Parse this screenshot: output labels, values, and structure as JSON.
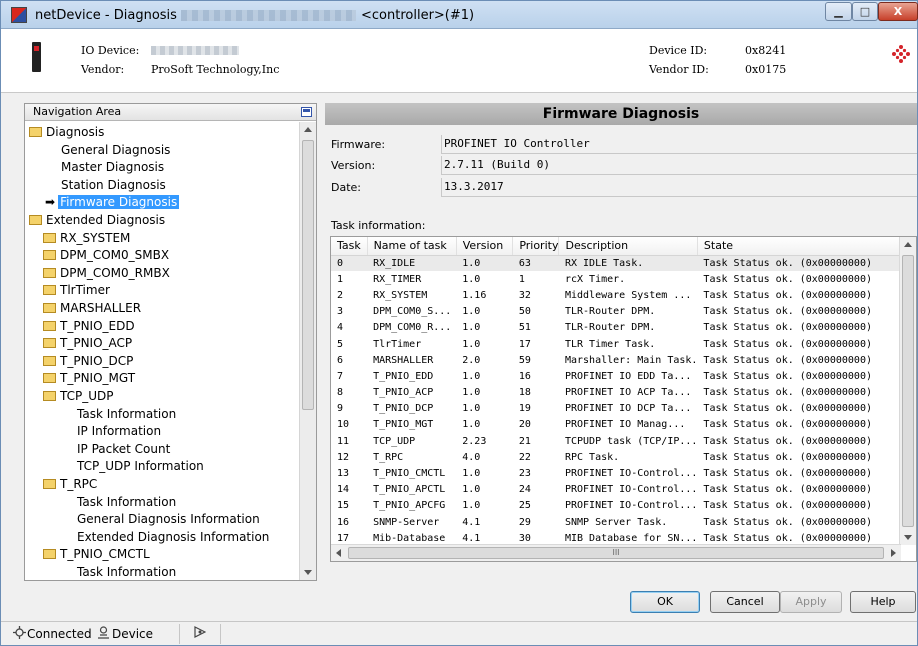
{
  "window": {
    "title": "netDevice - Diagnosis",
    "title_suffix": "<controller>(#1)",
    "minimize_glyph": "▁",
    "maximize_glyph": "□",
    "close_glyph": "X"
  },
  "header": {
    "io_device_label": "IO Device:",
    "vendor_label": "Vendor:",
    "vendor_value": "ProSoft Technology,Inc",
    "device_id_label": "Device ID:",
    "device_id_value": "0x8241",
    "vendor_id_label": "Vendor ID:",
    "vendor_id_value": "0x0175"
  },
  "nav": {
    "header": "Navigation Area",
    "items": [
      {
        "label": "Diagnosis",
        "level": 0,
        "folder": true
      },
      {
        "label": "General Diagnosis",
        "level": 1
      },
      {
        "label": "Master Diagnosis",
        "level": 1
      },
      {
        "label": "Station Diagnosis",
        "level": 1
      },
      {
        "label": "Firmware Diagnosis",
        "level": 1,
        "selected": true
      },
      {
        "label": "Extended Diagnosis",
        "level": 0,
        "folder": true
      },
      {
        "label": "RX_SYSTEM",
        "level": 1,
        "folder": true
      },
      {
        "label": "DPM_COM0_SMBX",
        "level": 1,
        "folder": true
      },
      {
        "label": "DPM_COM0_RMBX",
        "level": 1,
        "folder": true
      },
      {
        "label": "TlrTimer",
        "level": 1,
        "folder": true
      },
      {
        "label": "MARSHALLER",
        "level": 1,
        "folder": true
      },
      {
        "label": "T_PNIO_EDD",
        "level": 1,
        "folder": true
      },
      {
        "label": "T_PNIO_ACP",
        "level": 1,
        "folder": true
      },
      {
        "label": "T_PNIO_DCP",
        "level": 1,
        "folder": true
      },
      {
        "label": "T_PNIO_MGT",
        "level": 1,
        "folder": true
      },
      {
        "label": "TCP_UDP",
        "level": 1,
        "folder": true
      },
      {
        "label": "Task Information",
        "level": 2
      },
      {
        "label": "IP Information",
        "level": 2
      },
      {
        "label": "IP Packet Count",
        "level": 2
      },
      {
        "label": "TCP_UDP Information",
        "level": 2
      },
      {
        "label": "T_RPC",
        "level": 1,
        "folder": true
      },
      {
        "label": "Task Information",
        "level": 2
      },
      {
        "label": "General Diagnosis Information",
        "level": 2
      },
      {
        "label": "Extended Diagnosis Information",
        "level": 2
      },
      {
        "label": "T_PNIO_CMCTL",
        "level": 1,
        "folder": true
      },
      {
        "label": "Task Information",
        "level": 2
      }
    ]
  },
  "panel": {
    "title": "Firmware Diagnosis",
    "firmware_label": "Firmware:",
    "firmware_value": "PROFINET IO Controller",
    "version_label": "Version:",
    "version_value": "2.7.11 (Build 0)",
    "date_label": "Date:",
    "date_value": "13.3.2017",
    "task_info_label": "Task information:"
  },
  "table": {
    "columns": [
      "Task",
      "Name of task",
      "Version",
      "Priority",
      "Description",
      "State"
    ],
    "rows": [
      [
        "0",
        "RX_IDLE",
        "1.0",
        "63",
        "RX IDLE Task.",
        "Task Status ok. (0x00000000)"
      ],
      [
        "1",
        "RX_TIMER",
        "1.0",
        "1",
        "rcX Timer.",
        "Task Status ok. (0x00000000)"
      ],
      [
        "2",
        "RX_SYSTEM",
        "1.16",
        "32",
        "Middleware System ...",
        "Task Status ok. (0x00000000)"
      ],
      [
        "3",
        "DPM_COM0_S...",
        "1.0",
        "50",
        "TLR-Router DPM.",
        "Task Status ok. (0x00000000)"
      ],
      [
        "4",
        "DPM_COM0_R...",
        "1.0",
        "51",
        "TLR-Router DPM.",
        "Task Status ok. (0x00000000)"
      ],
      [
        "5",
        "TlrTimer",
        "1.0",
        "17",
        "TLR Timer Task.",
        "Task Status ok. (0x00000000)"
      ],
      [
        "6",
        "MARSHALLER",
        "2.0",
        "59",
        "Marshaller: Main Task.",
        "Task Status ok. (0x00000000)"
      ],
      [
        "7",
        "T_PNIO_EDD",
        "1.0",
        "16",
        "PROFINET IO EDD Ta...",
        "Task Status ok. (0x00000000)"
      ],
      [
        "8",
        "T_PNIO_ACP",
        "1.0",
        "18",
        "PROFINET IO ACP Ta...",
        "Task Status ok. (0x00000000)"
      ],
      [
        "9",
        "T_PNIO_DCP",
        "1.0",
        "19",
        "PROFINET IO DCP Ta...",
        "Task Status ok. (0x00000000)"
      ],
      [
        "10",
        "T_PNIO_MGT",
        "1.0",
        "20",
        "PROFINET IO Manag...",
        "Task Status ok. (0x00000000)"
      ],
      [
        "11",
        "TCP_UDP",
        "2.23",
        "21",
        "TCPUDP task (TCP/IP...",
        "Task Status ok. (0x00000000)"
      ],
      [
        "12",
        "T_RPC",
        "4.0",
        "22",
        "RPC Task.",
        "Task Status ok. (0x00000000)"
      ],
      [
        "13",
        "T_PNIO_CMCTL",
        "1.0",
        "23",
        "PROFINET IO-Control...",
        "Task Status ok. (0x00000000)"
      ],
      [
        "14",
        "T_PNIO_APCTL",
        "1.0",
        "24",
        "PROFINET IO-Control...",
        "Task Status ok. (0x00000000)"
      ],
      [
        "15",
        "T_PNIO_APCFG",
        "1.0",
        "25",
        "PROFINET IO-Control...",
        "Task Status ok. (0x00000000)"
      ],
      [
        "16",
        "SNMP-Server",
        "4.1",
        "29",
        "SNMP Server Task.",
        "Task Status ok. (0x00000000)"
      ],
      [
        "17",
        "Mib-Database",
        "4.1",
        "30",
        "MIB Database for SN...",
        "Task Status ok. (0x00000000)"
      ]
    ],
    "hscroll_grip": "III"
  },
  "buttons": {
    "ok": "OK",
    "cancel": "Cancel",
    "apply": "Apply",
    "help": "Help"
  },
  "status": {
    "connected": "Connected",
    "device": "Device"
  },
  "icons": {
    "app": "app-icon",
    "folder": "folder-icon",
    "arrow": "selection-arrow-icon",
    "connected": "connected-icon",
    "device": "device-icon",
    "network": "network-icon",
    "brand": "brand-logo-icon"
  },
  "colors": {
    "selection": "#3399ff",
    "panel_title_bg": "#b5b5b5",
    "title_bar": "#c4d8ef",
    "brand_red": "#d4232a"
  }
}
